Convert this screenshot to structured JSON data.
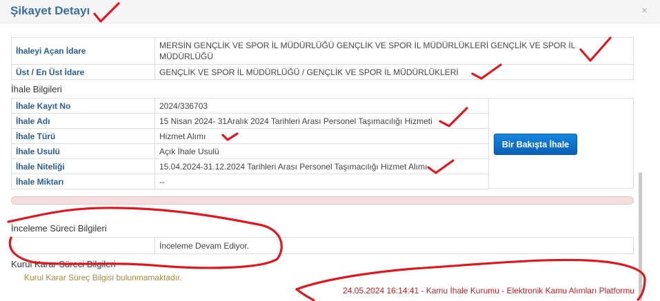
{
  "modal": {
    "title": "Şikayet Detayı",
    "close_label": "×"
  },
  "idare": {
    "rows": [
      {
        "label": "İhaleyi Açan İdare",
        "value": "MERSİN GENÇLİK VE SPOR İL MÜDÜRLÜĞÜ GENÇLİK VE SPOR İL MÜDÜRLÜKLERİ GENÇLİK VE SPOR İL MÜDÜRLÜĞÜ"
      },
      {
        "label": "Üst / En Üst İdare",
        "value": "GENÇLİK VE SPOR İL MÜDÜRLÜĞÜ / GENÇLİK VE SPOR İL MÜDÜRLÜKLERİ"
      }
    ]
  },
  "ihale": {
    "section_title": "İhale Bilgileri",
    "rows": [
      {
        "label": "İhale Kayıt No",
        "value": "2024/336703"
      },
      {
        "label": "İhale Adı",
        "value": "15 Nisan 2024- 31Aralık 2024 Tarihleri Arası Personel Taşımacılığı Hizmeti"
      },
      {
        "label": "İhale Türü",
        "value": "Hizmet Alımı"
      },
      {
        "label": "İhale Usulü",
        "value": "Açık İhale Usulü"
      },
      {
        "label": "İhale Niteliği",
        "value": "15.04.2024-31.12.2024 Tarihleri Arası Personel Taşımacılığı Hizmet Alımı"
      },
      {
        "label": "İhale Miktarı",
        "value": "--"
      }
    ],
    "button_label": "Bir Bakışta İhale"
  },
  "inceleme": {
    "section_title": "İnceleme Süreci Bilgileri",
    "status": "İnceleme Devam Ediyor."
  },
  "kurul": {
    "section_title": "Kurul Karar Süreci Bilgileri",
    "note": "Kurul Karar Süreç Bilgisi bulunmamaktadır."
  },
  "footer": {
    "text": "24.05.2024 16:14:41 - Kamu İhale Kurumu - Elektronik Kamu Alımları Platformu"
  },
  "colors": {
    "accent": "#3a6ea5",
    "label": "#2a5b9a",
    "button": "#0a6fca",
    "footer": "#c02226",
    "annotation": "#e0161c"
  }
}
